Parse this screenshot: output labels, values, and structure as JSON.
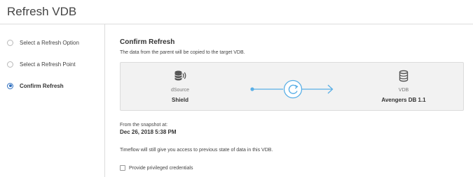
{
  "page": {
    "title": "Refresh VDB"
  },
  "steps": [
    {
      "label": "Select a Refresh Option",
      "active": false
    },
    {
      "label": "Select a Refresh Point",
      "active": false
    },
    {
      "label": "Confirm Refresh",
      "active": true
    }
  ],
  "confirm": {
    "heading": "Confirm Refresh",
    "description": "The data from the parent will be copied to the target VDB.",
    "source": {
      "type": "dSource",
      "name": "Shield",
      "icon": "dsource-database-icon"
    },
    "target": {
      "type": "VDB",
      "name": "Avengers DB 1.1",
      "icon": "vdb-database-icon"
    },
    "flow_icon": "refresh-icon",
    "snapshot_label": "From the snapshot at:",
    "snapshot_value": "Dec 26, 2018 5:38 PM",
    "timeflow_note": "Timeflow will still give you access to previous state of data in this VDB.",
    "credentials_label": "Provide privileged credentials",
    "credentials_checked": false
  },
  "colors": {
    "accent": "#5aafe6",
    "active_step": "#2f6fc0"
  }
}
